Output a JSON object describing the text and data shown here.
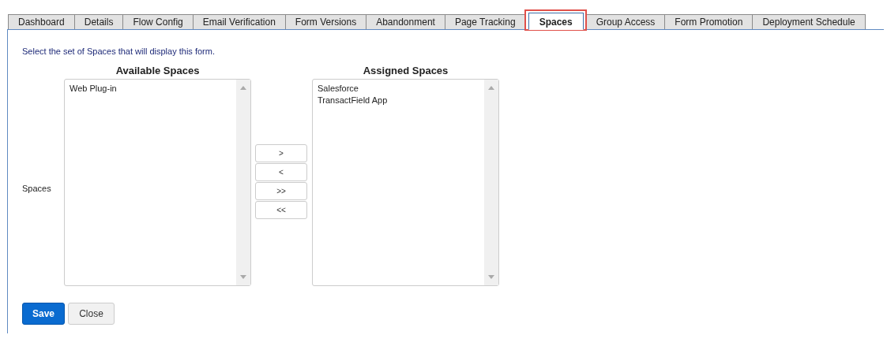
{
  "tabs": [
    {
      "label": "Dashboard",
      "selected": false,
      "highlighted": false
    },
    {
      "label": "Details",
      "selected": false,
      "highlighted": false
    },
    {
      "label": "Flow Config",
      "selected": false,
      "highlighted": false
    },
    {
      "label": "Email Verification",
      "selected": false,
      "highlighted": false
    },
    {
      "label": "Form Versions",
      "selected": false,
      "highlighted": false
    },
    {
      "label": "Abandonment",
      "selected": false,
      "highlighted": false
    },
    {
      "label": "Page Tracking",
      "selected": false,
      "highlighted": false
    },
    {
      "label": "Spaces",
      "selected": true,
      "highlighted": true
    },
    {
      "label": "Group Access",
      "selected": false,
      "highlighted": false
    },
    {
      "label": "Form Promotion",
      "selected": false,
      "highlighted": false
    },
    {
      "label": "Deployment Schedule",
      "selected": false,
      "highlighted": false
    }
  ],
  "instruction": "Select the set of Spaces that will display this form.",
  "field_label": "Spaces",
  "available": {
    "heading": "Available Spaces",
    "items": [
      "Web Plug-in"
    ]
  },
  "move_buttons": [
    ">",
    "<",
    ">>",
    "<<"
  ],
  "assigned": {
    "heading": "Assigned Spaces",
    "items": [
      "Salesforce",
      "TransactField App"
    ]
  },
  "buttons": [
    {
      "label": "Save",
      "kind": "primary"
    },
    {
      "label": "Close",
      "kind": "secondary"
    }
  ]
}
